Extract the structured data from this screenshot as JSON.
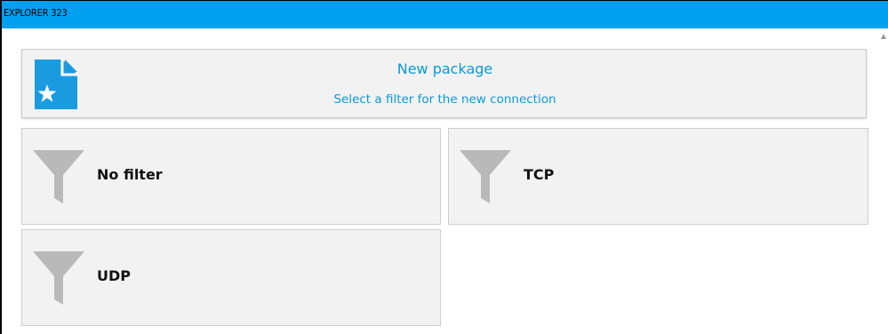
{
  "window": {
    "title": "EXPLORER 323",
    "titlebar_color": "#00a0f0"
  },
  "header": {
    "title": "New package",
    "subtitle": "Select a filter for the new connection",
    "icon": "new-document-star-icon",
    "accent_color": "#0a9ad8"
  },
  "filters": [
    {
      "label": "No filter",
      "icon": "funnel-icon"
    },
    {
      "label": "TCP",
      "icon": "funnel-icon"
    },
    {
      "label": "UDP",
      "icon": "funnel-icon"
    }
  ],
  "scrollbar": {
    "icon": "scroll-up-icon"
  }
}
